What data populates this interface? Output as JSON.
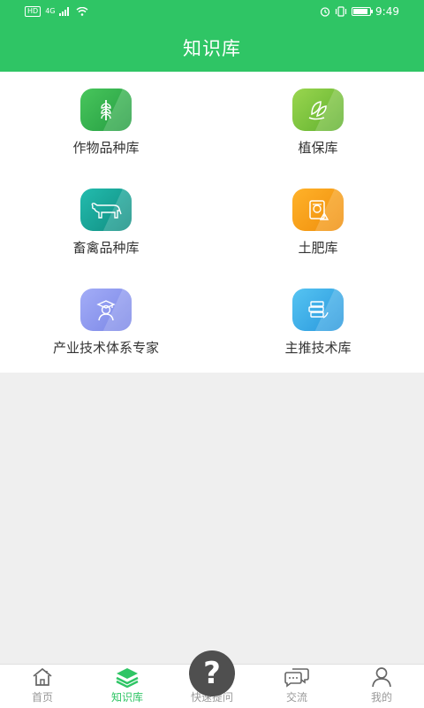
{
  "status_bar": {
    "hd": "HD",
    "network": "4G",
    "time": "9:49",
    "battery_level": 0.9
  },
  "header": {
    "title": "知识库"
  },
  "grid": {
    "items": [
      {
        "label": "作物品种库",
        "icon": "wheat-icon",
        "color_from": "#3fbf55",
        "color_to": "#2aa546"
      },
      {
        "label": "植保库",
        "icon": "leaf-hand-icon",
        "color_from": "#8fd247",
        "color_to": "#67b832"
      },
      {
        "label": "畜禽品种库",
        "icon": "cow-icon",
        "color_from": "#1fb6a8",
        "color_to": "#129386"
      },
      {
        "label": "土肥库",
        "icon": "fertilizer-icon",
        "color_from": "#ffae20",
        "color_to": "#f0920e"
      },
      {
        "label": "产业技术体系专家",
        "icon": "expert-icon",
        "color_from": "#9aa6f5",
        "color_to": "#7f8bea"
      },
      {
        "label": "主推技术库",
        "icon": "books-icon",
        "color_from": "#4fc0f0",
        "color_to": "#2d9fe0"
      }
    ]
  },
  "tabs": [
    {
      "label": "首页",
      "icon": "home-icon",
      "active": false
    },
    {
      "label": "知识库",
      "icon": "layers-icon",
      "active": true
    },
    {
      "label": "快速提问",
      "icon": "question-icon",
      "active": false
    },
    {
      "label": "交流",
      "icon": "chat-icon",
      "active": false
    },
    {
      "label": "我的",
      "icon": "user-icon",
      "active": false
    }
  ],
  "colors": {
    "brand": "#2fc565",
    "tab_inactive": "#999999"
  }
}
